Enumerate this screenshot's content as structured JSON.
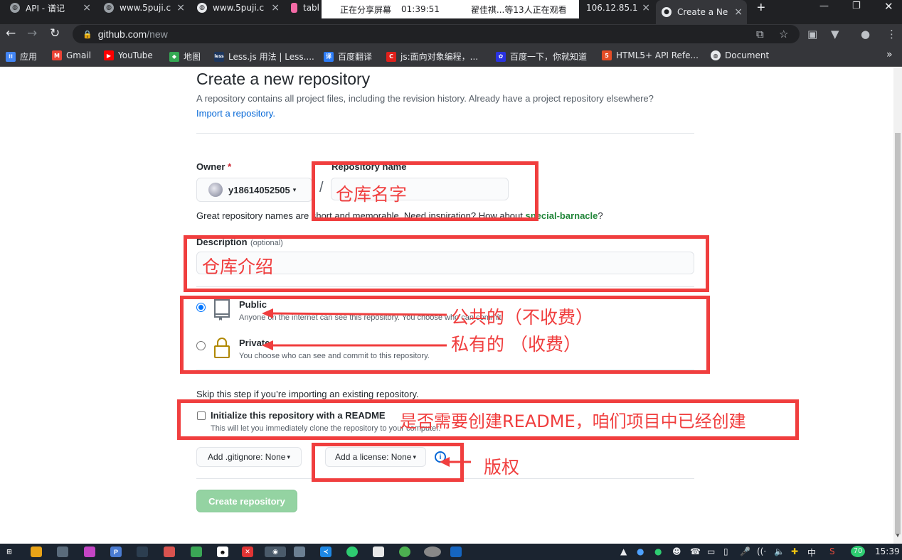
{
  "browser": {
    "tabs": [
      {
        "label": "API - 谱记"
      },
      {
        "label": "www.5puji.c"
      },
      {
        "label": "www.5puji.c"
      },
      {
        "label": "tabl"
      },
      {
        "label": "106.12.85.1"
      },
      {
        "label": "Create a Ne"
      }
    ],
    "share_banner": {
      "status": "正在分享屏幕",
      "timer": "01:39:51",
      "viewers": "翟佳祺...等13人正在观看"
    },
    "url_host": "github.com",
    "url_path": "/new",
    "bookmarks": [
      {
        "label": "应用"
      },
      {
        "label": "Gmail"
      },
      {
        "label": "YouTube"
      },
      {
        "label": "地图"
      },
      {
        "label": "Less.js 用法 | Less...."
      },
      {
        "label": "百度翻译"
      },
      {
        "label": "js:面向对象编程，..."
      },
      {
        "label": "百度一下，你就知道"
      },
      {
        "label": "HTML5+ API Refe..."
      },
      {
        "label": "Document"
      }
    ],
    "bookmarks_more": "»"
  },
  "page": {
    "title": "Create a new repository",
    "intro": "A repository contains all project files, including the revision history. Already have a project repository elsewhere?",
    "import_link": "Import a repository.",
    "owner_label": "Owner",
    "required_mark": "*",
    "owner_value": "y18614052505",
    "slash": "/",
    "repo_name_label": "Repository name",
    "hint_prefix": "Great repository names are short and memorable. Need inspiration? How about",
    "hint_suggestion": "special-barnacle",
    "hint_suffix": "?",
    "description_label": "Description",
    "description_optional": "(optional)",
    "visibility": {
      "public_title": "Public",
      "public_desc": "Anyone on the internet can see this repository. You choose who can commit.",
      "private_title": "Private",
      "private_desc": "You choose who can see and commit to this repository.",
      "selected": "public"
    },
    "skip_text": "Skip this step if you’re importing an existing repository.",
    "readme_label": "Initialize this repository with a README",
    "readme_desc": "This will let you immediately clone the repository to your computer.",
    "gitignore_select": "Add .gitignore: None",
    "license_select": "Add a license: None",
    "info_glyph": "i",
    "create_button": "Create repository"
  },
  "annotations": {
    "repo_name": "仓库名字",
    "description": "仓库介绍",
    "public": "公共的（不收费）",
    "private": "私有的 （收费）",
    "readme": "是否需要创建README，咱们项目中已经创建",
    "license": "版权"
  },
  "taskbar": {
    "ime": "中",
    "badge": "70",
    "clock": "15:39"
  }
}
